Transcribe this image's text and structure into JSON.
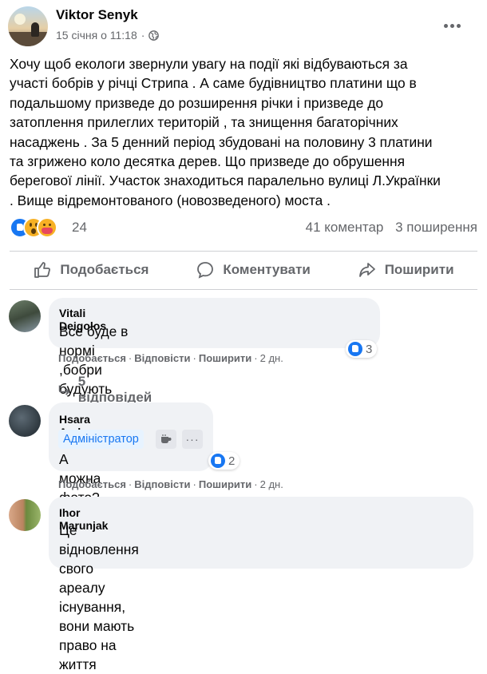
{
  "post": {
    "author": "Viktor Senyk",
    "timestamp": "15 січня о 11:18",
    "dot": "·",
    "text": "Хочу щоб екологи звернули увагу на події які відбуваються за\nучасті бобрів у річці Стрипа . А саме будівництво платини що в\nподальшому призведе до розширення річки і призведе до\nзатоплення прилеглих територій , та знищення багаторічних\nнасаджень . За 5 денний період збудовані на половину 3 платини\nта згрижено коло десятка дерев. Що призведе до обрушення\nберегової лінії.  Участок знаходиться паралельно вулиці Л.Українки\n. Вище відремонтованого (новозведеного) моста  .",
    "reaction_count": "24",
    "comments_count": "41 коментар",
    "shares_count": "3 поширення",
    "reactions": [
      "like",
      "wow",
      "care"
    ]
  },
  "actions": {
    "like": "Подобається",
    "comment": "Коментувати",
    "share": "Поширити"
  },
  "comments": [
    {
      "name": "Vitali Deigolos",
      "text": "Все буде в нормі ,бобри будують екосистему",
      "like": "Подобається",
      "reply": "Відповісти",
      "share": "Поширити",
      "age": "2 дн.",
      "reaction_count": "3",
      "replies_label": "5 відповідей"
    },
    {
      "name": "Hsara Anderson",
      "badge": "Адміністратор",
      "text": "А можна фото?",
      "like": "Подобається",
      "reply": "Відповісти",
      "share": "Поширити",
      "age": "2 дн.",
      "reaction_count": "2"
    },
    {
      "name": "Ihor Marunjak",
      "text": "Це відновлення свого ареалу існування, вони мають\nправо на життя"
    }
  ],
  "colors": {
    "accent": "#1877f2",
    "muted_text": "#65676b",
    "bubble": "#f0f2f5"
  },
  "icons": [
    "globe-icon",
    "more-icon",
    "like-icon",
    "comment-icon",
    "share-icon",
    "reply-arrow-icon",
    "coffee-icon"
  ]
}
